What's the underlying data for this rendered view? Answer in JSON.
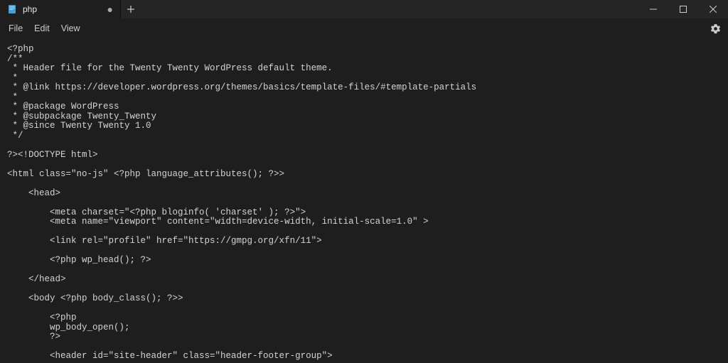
{
  "tab": {
    "label": "php",
    "dirty_marker": "●"
  },
  "menu": {
    "file": "File",
    "edit": "Edit",
    "view": "View"
  },
  "editor": {
    "content": "<?php\n/**\n * Header file for the Twenty Twenty WordPress default theme.\n *\n * @link https://developer.wordpress.org/themes/basics/template-files/#template-partials\n *\n * @package WordPress\n * @subpackage Twenty_Twenty\n * @since Twenty Twenty 1.0\n */\n\n?><!DOCTYPE html>\n\n<html class=\"no-js\" <?php language_attributes(); ?>>\n\n    <head>\n\n        <meta charset=\"<?php bloginfo( 'charset' ); ?>\">\n        <meta name=\"viewport\" content=\"width=device-width, initial-scale=1.0\" >\n\n        <link rel=\"profile\" href=\"https://gmpg.org/xfn/11\">\n\n        <?php wp_head(); ?>\n\n    </head>\n\n    <body <?php body_class(); ?>>\n\n        <?php\n        wp_body_open();\n        ?>\n\n        <header id=\"site-header\" class=\"header-footer-group\">"
  }
}
